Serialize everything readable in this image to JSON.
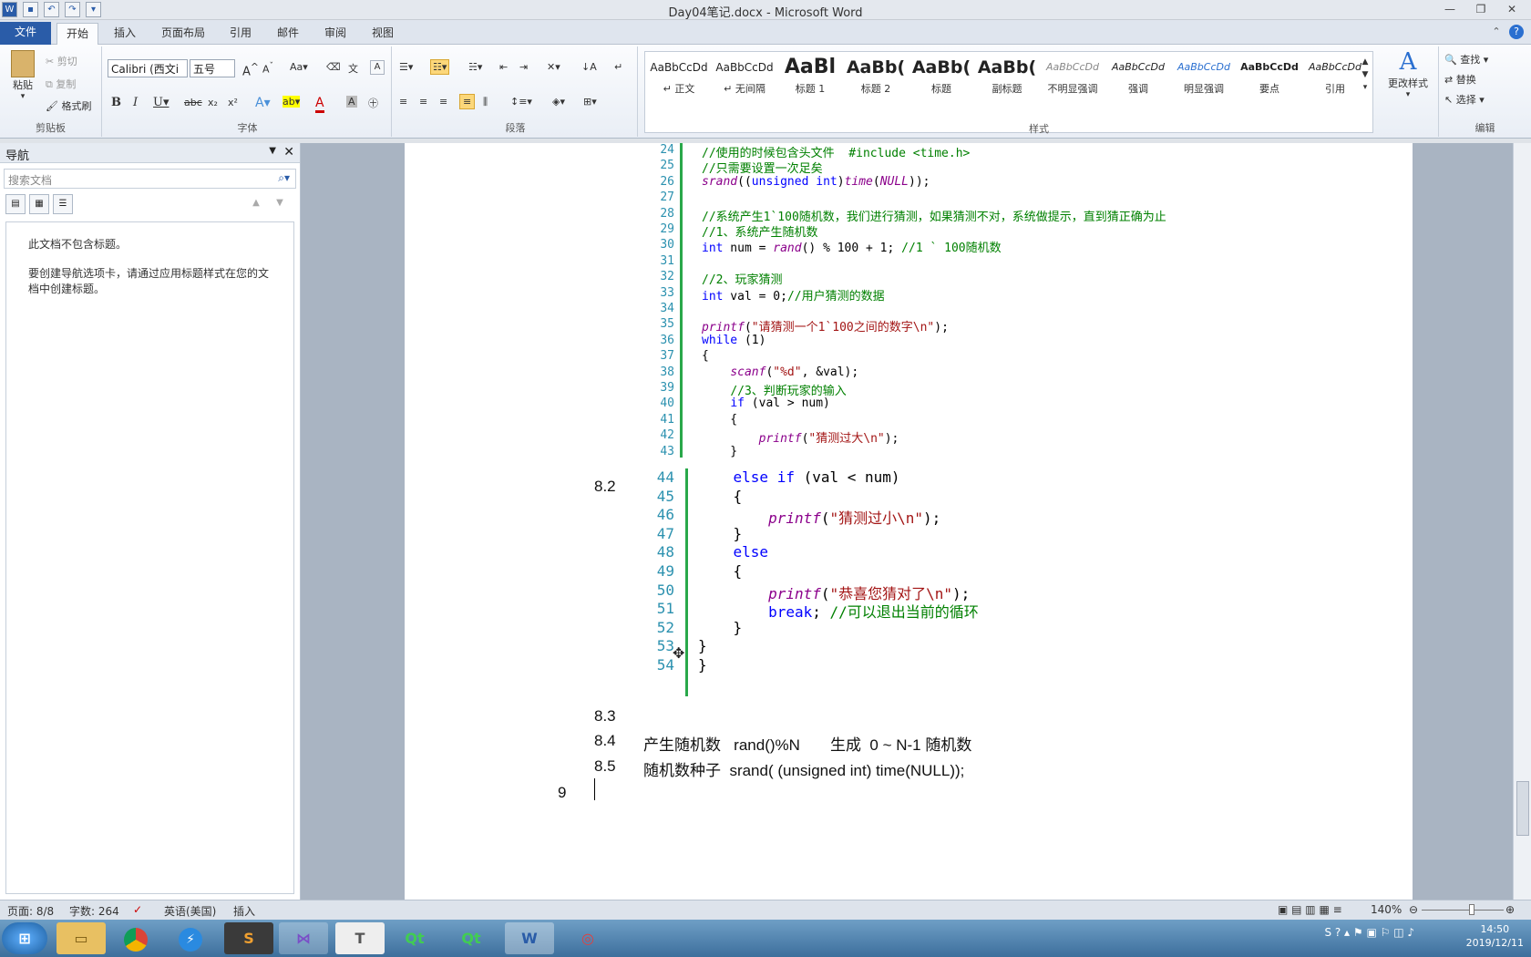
{
  "window": {
    "title": "Day04笔记.docx - Microsoft Word"
  },
  "tabs": {
    "file": "文件",
    "items": [
      "开始",
      "插入",
      "页面布局",
      "引用",
      "邮件",
      "审阅",
      "视图"
    ]
  },
  "ribbon": {
    "clipboard": {
      "paste": "粘贴",
      "cut": "剪切",
      "copy": "复制",
      "format_painter": "格式刷",
      "label": "剪贴板"
    },
    "font": {
      "name": "Calibri (西文i",
      "size": "五号",
      "label": "字体"
    },
    "paragraph": {
      "label": "段落"
    },
    "styles": {
      "label": "样式",
      "items": [
        {
          "preview": "AaBbCcDd",
          "name": "↵ 正文"
        },
        {
          "preview": "AaBbCcDd",
          "name": "↵ 无间隔"
        },
        {
          "preview": "AaBl",
          "name": "标题 1"
        },
        {
          "preview": "AaBb(",
          "name": "标题 2"
        },
        {
          "preview": "AaBb(",
          "name": "标题"
        },
        {
          "preview": "AaBb(",
          "name": "副标题"
        },
        {
          "preview": "AaBbCcDd",
          "name": "不明显强调"
        },
        {
          "preview": "AaBbCcDd",
          "name": "强调"
        },
        {
          "preview": "AaBbCcDd",
          "name": "明显强调"
        },
        {
          "preview": "AaBbCcDd",
          "name": "要点"
        },
        {
          "preview": "AaBbCcDd",
          "name": "引用"
        }
      ],
      "change_styles": "更改样式"
    },
    "editing": {
      "find": "查找",
      "replace": "替换",
      "select": "选择",
      "label": "编辑"
    }
  },
  "nav": {
    "title": "导航",
    "search_placeholder": "搜索文档",
    "msg1": "此文档不包含标题。",
    "msg2": "要创建导航选项卡，请通过应用标题样式在您的文档中创建标题。"
  },
  "code_top": [
    {
      "n": "24",
      "t": "//使用的时候包含头文件  #include <time.h>"
    },
    {
      "n": "25",
      "t": "//只需要设置一次足矣"
    },
    {
      "n": "26",
      "t": "srand((unsigned int)time(NULL));"
    },
    {
      "n": "27",
      "t": ""
    },
    {
      "n": "28",
      "t": "//系统产生1`100随机数，我们进行猜测，如果猜测不对，系统做提示，直到猜正确为止"
    },
    {
      "n": "29",
      "t": "//1、系统产生随机数"
    },
    {
      "n": "30",
      "t": "int num = rand() % 100 + 1; //1 ` 100随机数"
    },
    {
      "n": "31",
      "t": ""
    },
    {
      "n": "32",
      "t": "//2、玩家猜测"
    },
    {
      "n": "33",
      "t": "int val = 0;//用户猜测的数据"
    },
    {
      "n": "34",
      "t": ""
    },
    {
      "n": "35",
      "t": "printf(\"请猜测一个1`100之间的数字\\n\");"
    },
    {
      "n": "36",
      "t": "while (1)"
    },
    {
      "n": "37",
      "t": "{"
    },
    {
      "n": "38",
      "t": "    scanf(\"%d\", &val);"
    },
    {
      "n": "39",
      "t": "    //3、判断玩家的输入"
    },
    {
      "n": "40",
      "t": "    if (val > num)"
    },
    {
      "n": "41",
      "t": "    {"
    },
    {
      "n": "42",
      "t": "        printf(\"猜测过大\\n\");"
    },
    {
      "n": "43",
      "t": "    }"
    }
  ],
  "code_bottom": [
    {
      "n": "44",
      "t": "    else if (val < num)"
    },
    {
      "n": "45",
      "t": "    {"
    },
    {
      "n": "46",
      "t": "        printf(\"猜测过小\\n\");"
    },
    {
      "n": "47",
      "t": "    }"
    },
    {
      "n": "48",
      "t": "    else"
    },
    {
      "n": "49",
      "t": "    {"
    },
    {
      "n": "50",
      "t": "        printf(\"恭喜您猜对了\\n\");"
    },
    {
      "n": "51",
      "t": "        break; //可以退出当前的循环"
    },
    {
      "n": "52",
      "t": "    }"
    },
    {
      "n": "53",
      "t": "}"
    },
    {
      "n": "54",
      "t": "}"
    }
  ],
  "headings": [
    {
      "num": "8.2",
      "text": ""
    },
    {
      "num": "8.3",
      "text": ""
    },
    {
      "num": "8.4",
      "text": "产生随机数   rand()%N       生成  0 ~ N-1 随机数"
    },
    {
      "num": "8.5",
      "text": "随机数种子  srand( (unsigned int) time(NULL));"
    },
    {
      "num": "9",
      "text": ""
    }
  ],
  "status": {
    "page": "页面: 8/8",
    "words": "字数: 264",
    "lang": "英语(美国)",
    "mode": "插入",
    "zoom": "140%"
  },
  "taskbar": {
    "apps": [
      "chrome-icon",
      "thunder-icon",
      "sublime-icon",
      "visual-studio-icon",
      "typora-icon",
      "qt-icon",
      "qt-icon",
      "word-icon",
      "other-icon"
    ],
    "time": "14:50",
    "date": "2019/12/11"
  },
  "colors": {
    "accent": "#2a5ca8",
    "code_comment": "#008000",
    "code_keyword": "#0000ff",
    "code_string": "#a31515",
    "line_number": "#2b91af"
  }
}
